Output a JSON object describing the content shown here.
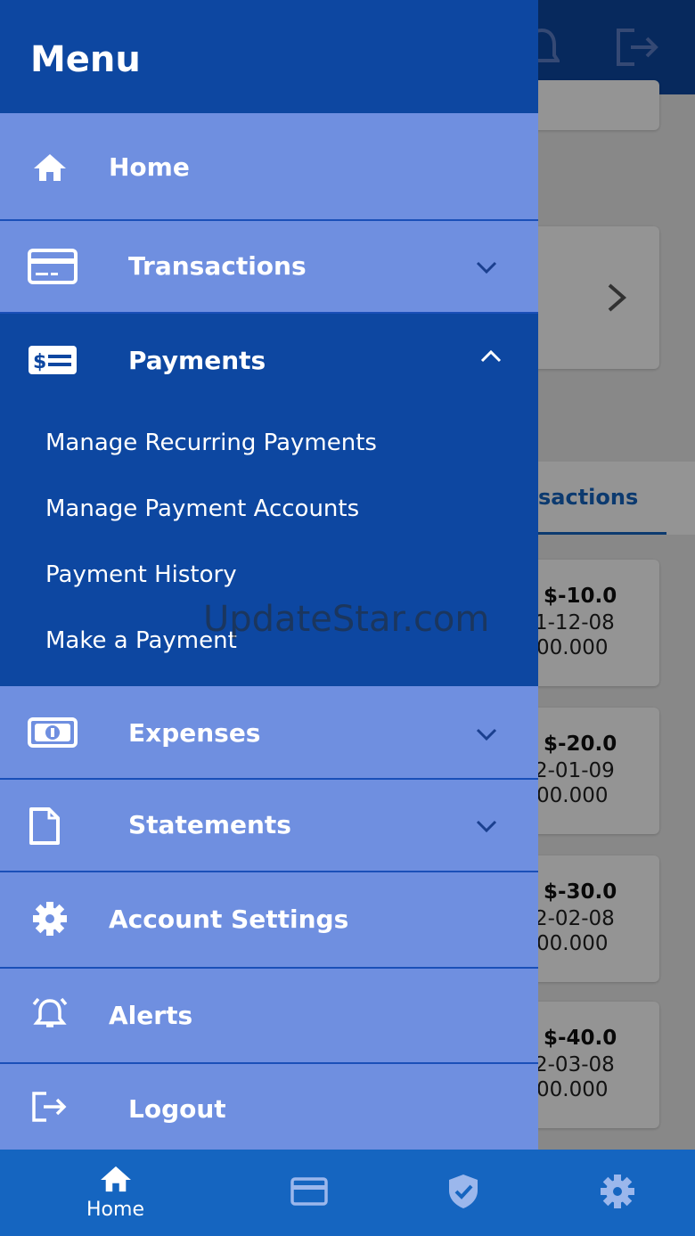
{
  "drawer": {
    "title": "Menu",
    "items": [
      {
        "label": "Home",
        "icon": "home-icon"
      },
      {
        "label": "Transactions",
        "icon": "card-icon",
        "expandable": true,
        "expanded": false
      },
      {
        "label": "Payments",
        "icon": "payment-icon",
        "expandable": true,
        "expanded": true,
        "subitems": [
          {
            "label": "Manage Recurring Payments"
          },
          {
            "label": "Manage Payment Accounts"
          },
          {
            "label": "Payment History"
          },
          {
            "label": "Make a Payment"
          }
        ]
      },
      {
        "label": "Expenses",
        "icon": "money-icon",
        "expandable": true,
        "expanded": false
      },
      {
        "label": "Statements",
        "icon": "document-icon",
        "expandable": true,
        "expanded": false
      },
      {
        "label": "Account Settings",
        "icon": "gear-icon"
      },
      {
        "label": "Alerts",
        "icon": "alarm-icon"
      },
      {
        "label": "Logout",
        "icon": "logout-icon"
      }
    ]
  },
  "background": {
    "tab_label": "sactions",
    "transactions": [
      {
        "amount": "$-10.0",
        "date": "1-12-08",
        "balance": "00.000"
      },
      {
        "amount": "$-20.0",
        "date": "2-01-09",
        "balance": "00.000"
      },
      {
        "amount": "$-30.0",
        "date": "2-02-08",
        "balance": "00.000"
      },
      {
        "amount": "$-40.0",
        "date": "2-03-08",
        "balance": "00.000"
      }
    ]
  },
  "bottom_nav": [
    {
      "label": "Home",
      "icon": "home-icon",
      "active": true
    },
    {
      "label": "",
      "icon": "card-icon"
    },
    {
      "label": "",
      "icon": "shield-check-icon"
    },
    {
      "label": "",
      "icon": "gear-icon"
    }
  ],
  "watermark": "UpdateStar.com",
  "colors": {
    "primary_dark": "#0d47a1",
    "menu_item_bg": "#6f8fe0",
    "bottom_nav_bg": "#1565c0",
    "text_light": "#ffffff"
  }
}
